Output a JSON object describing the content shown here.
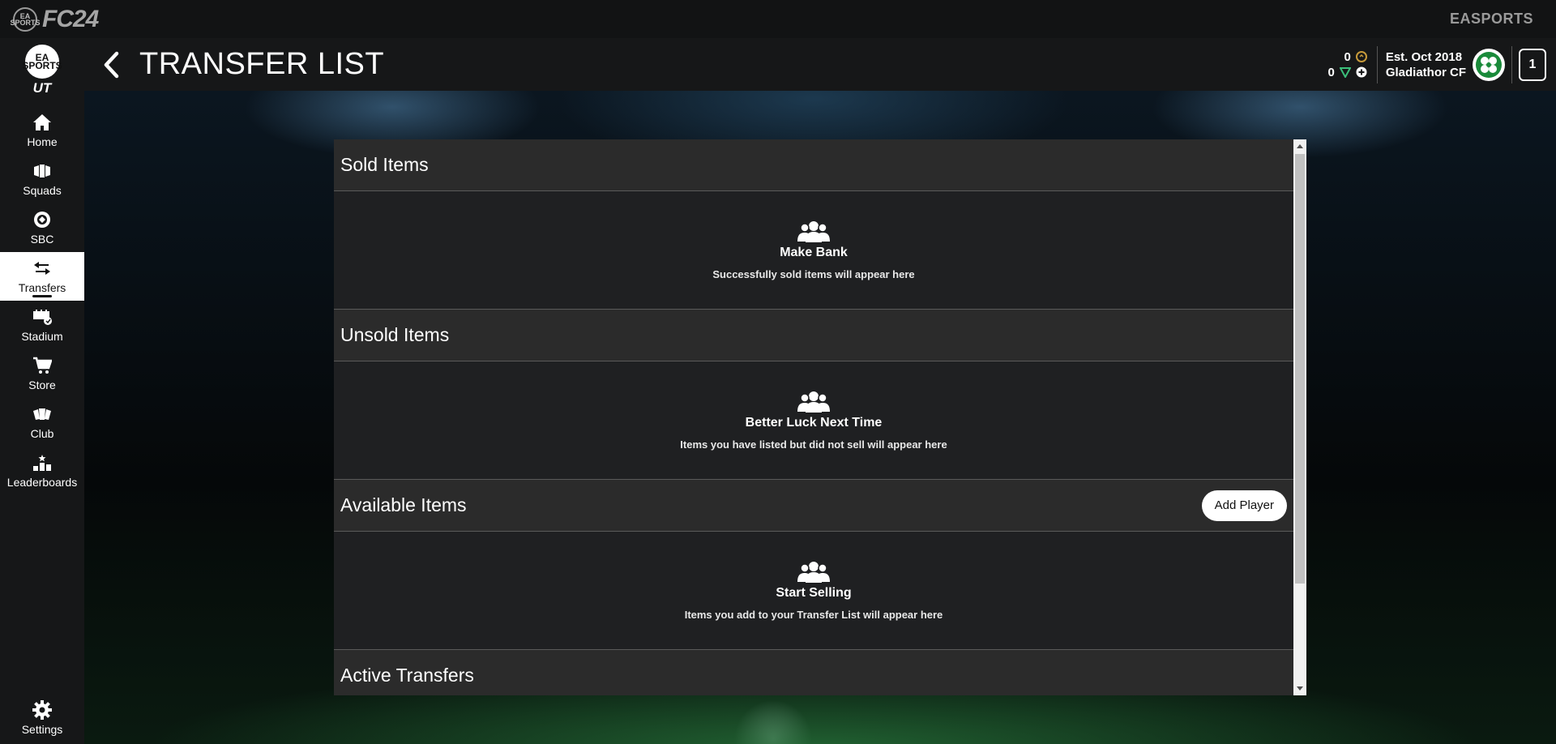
{
  "topbar": {
    "brand_badge": "EA SPORTS",
    "brand": "FC24",
    "publisher": "EASPORTS"
  },
  "sidebar": {
    "logo_badge": "EA SPORTS",
    "logo_text": "UT",
    "items": [
      {
        "label": "Home",
        "icon": "home-icon"
      },
      {
        "label": "Squads",
        "icon": "squads-icon"
      },
      {
        "label": "SBC",
        "icon": "sbc-icon"
      },
      {
        "label": "Transfers",
        "icon": "transfers-icon",
        "active": true
      },
      {
        "label": "Stadium",
        "icon": "stadium-icon"
      },
      {
        "label": "Store",
        "icon": "store-icon"
      },
      {
        "label": "Club",
        "icon": "club-icon"
      },
      {
        "label": "Leaderboards",
        "icon": "leaderboards-icon"
      }
    ],
    "settings_label": "Settings"
  },
  "header": {
    "title": "TRANSFER LIST",
    "coins": "0",
    "points": "0",
    "established": "Est. Oct 2018",
    "club_name": "Gladiathor CF",
    "season_badge": "1"
  },
  "sections": [
    {
      "title": "Sold Items",
      "empty_title": "Make Bank",
      "empty_text": "Successfully sold items will appear here"
    },
    {
      "title": "Unsold Items",
      "empty_title": "Better Luck Next Time",
      "empty_text": "Items you have listed but did not sell will appear here"
    },
    {
      "title": "Available Items",
      "button": "Add Player",
      "empty_title": "Start Selling",
      "empty_text": "Items you add to your Transfer List will appear here"
    },
    {
      "title": "Active Transfers"
    }
  ],
  "colors": {
    "accent": "#ffffff",
    "panel": "#1f2022",
    "section_header": "#2b2b2b",
    "club_crest": "#1a8a3a"
  }
}
